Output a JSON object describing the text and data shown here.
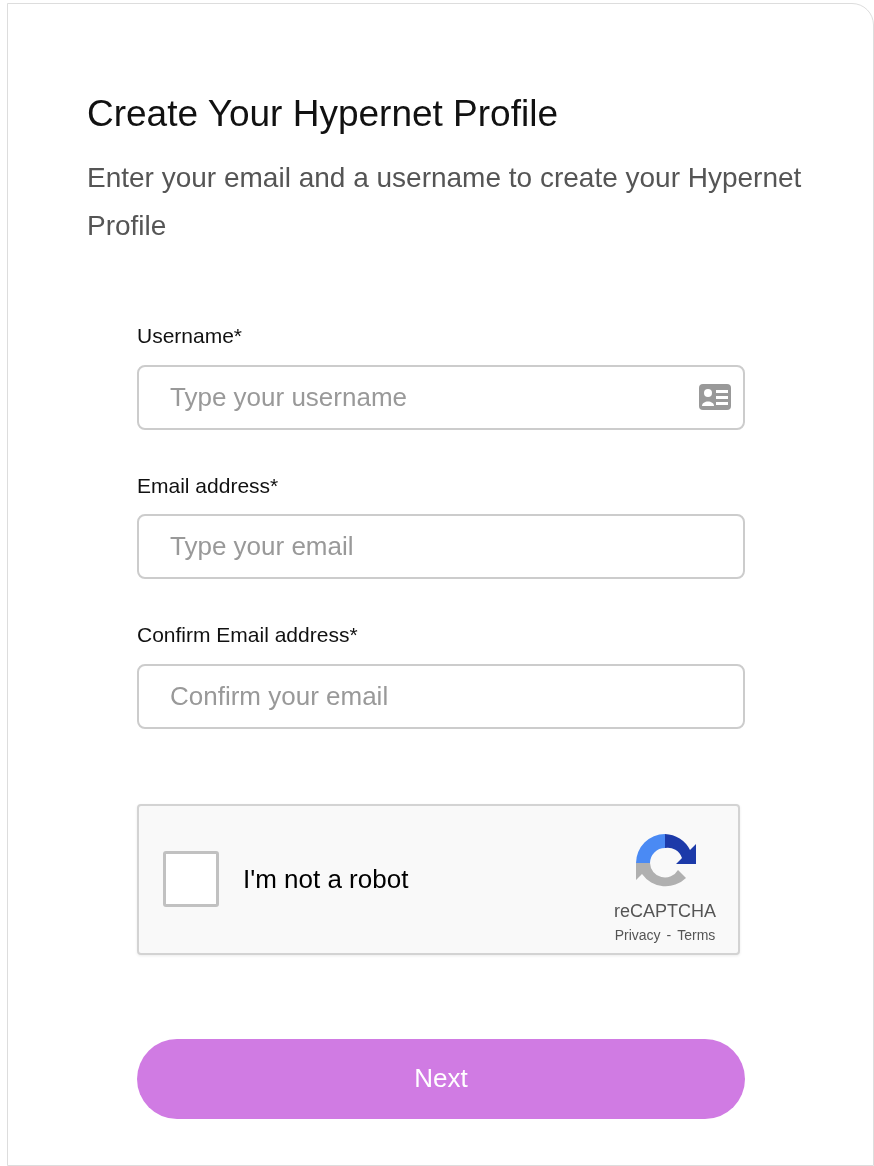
{
  "title": "Create Your Hypernet Profile",
  "subtitle": "Enter your email and a username to create your Hypernet Profile",
  "fields": [
    {
      "label": "Username*",
      "placeholder": "Type your username",
      "kind": "contact"
    },
    {
      "label": "Email address*",
      "placeholder": "Type your email",
      "kind": "plain"
    },
    {
      "label": "Confirm Email address*",
      "placeholder": "Confirm your email",
      "kind": "plain"
    }
  ],
  "captcha": {
    "label": "I'm not a robot",
    "checked": false,
    "brand": "reCAPTCHA",
    "links": [
      "Privacy",
      "-",
      "Terms"
    ]
  },
  "button": "Next"
}
